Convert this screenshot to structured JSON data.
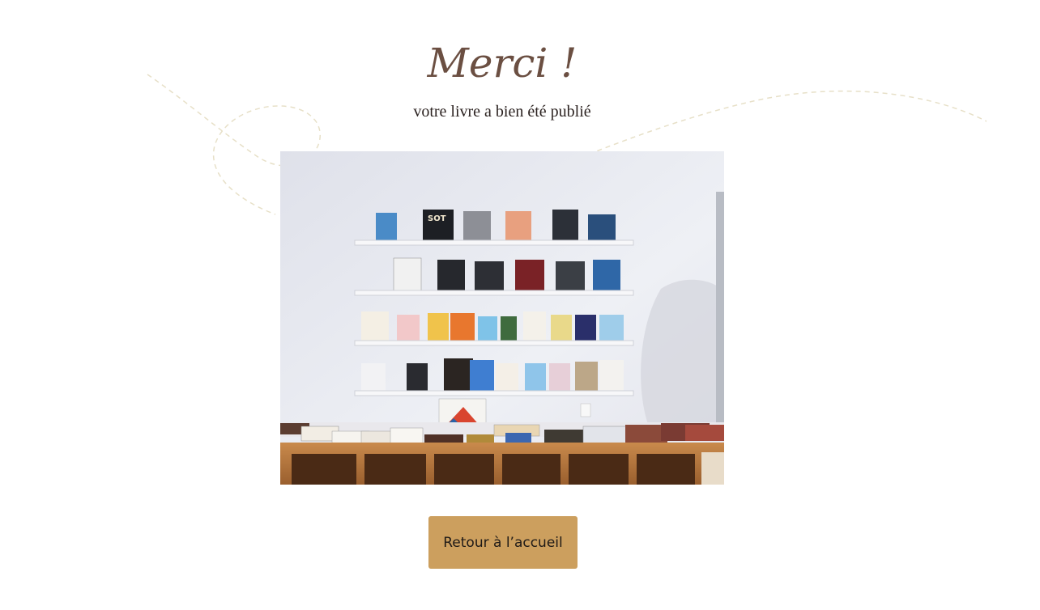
{
  "heading": {
    "title": "Merci !",
    "subtitle": "votre livre a bien été publié"
  },
  "hero_image": {
    "alt": "Étagères murales présentant des livres et magazines"
  },
  "actions": {
    "home_button_label": "Retour à l’accueil"
  },
  "colors": {
    "title": "#6b4f42",
    "button": "#cc9f5e",
    "decor_line": "#e7e0c8"
  }
}
